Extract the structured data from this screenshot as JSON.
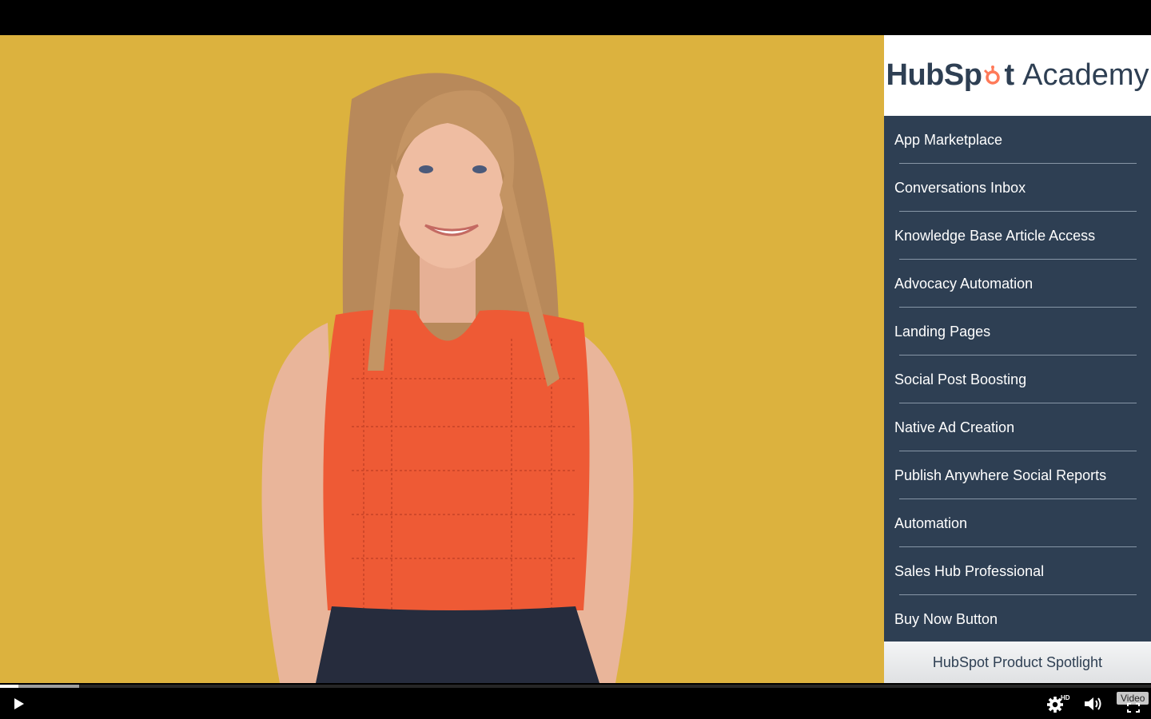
{
  "logo": {
    "brand_start": "HubSp",
    "brand_end": "t",
    "academy": "Academy"
  },
  "menu": {
    "items": [
      {
        "label": "App Marketplace"
      },
      {
        "label": "Conversations Inbox"
      },
      {
        "label": "Knowledge Base Article Access"
      },
      {
        "label": "Advocacy Automation"
      },
      {
        "label": "Landing Pages"
      },
      {
        "label": "Social Post Boosting"
      },
      {
        "label": "Native Ad Creation"
      },
      {
        "label": "Publish Anywhere Social Reports"
      },
      {
        "label": "Automation"
      },
      {
        "label": "Sales Hub Professional"
      },
      {
        "label": "Buy Now Button"
      }
    ]
  },
  "footer": {
    "label": "HubSpot Product Spotlight"
  },
  "player": {
    "progress_played": 0.016,
    "progress_buffered": 0.069,
    "hd_label": "HD",
    "video_badge": "Video"
  },
  "colors": {
    "background_yellow": "#dcb23e",
    "sidebar_navy": "#2e3f53",
    "brand_orange": "#ff7a59"
  },
  "icons": [
    "play-icon",
    "settings-gear-icon",
    "volume-icon",
    "fullscreen-icon",
    "sprocket-logo-icon"
  ]
}
